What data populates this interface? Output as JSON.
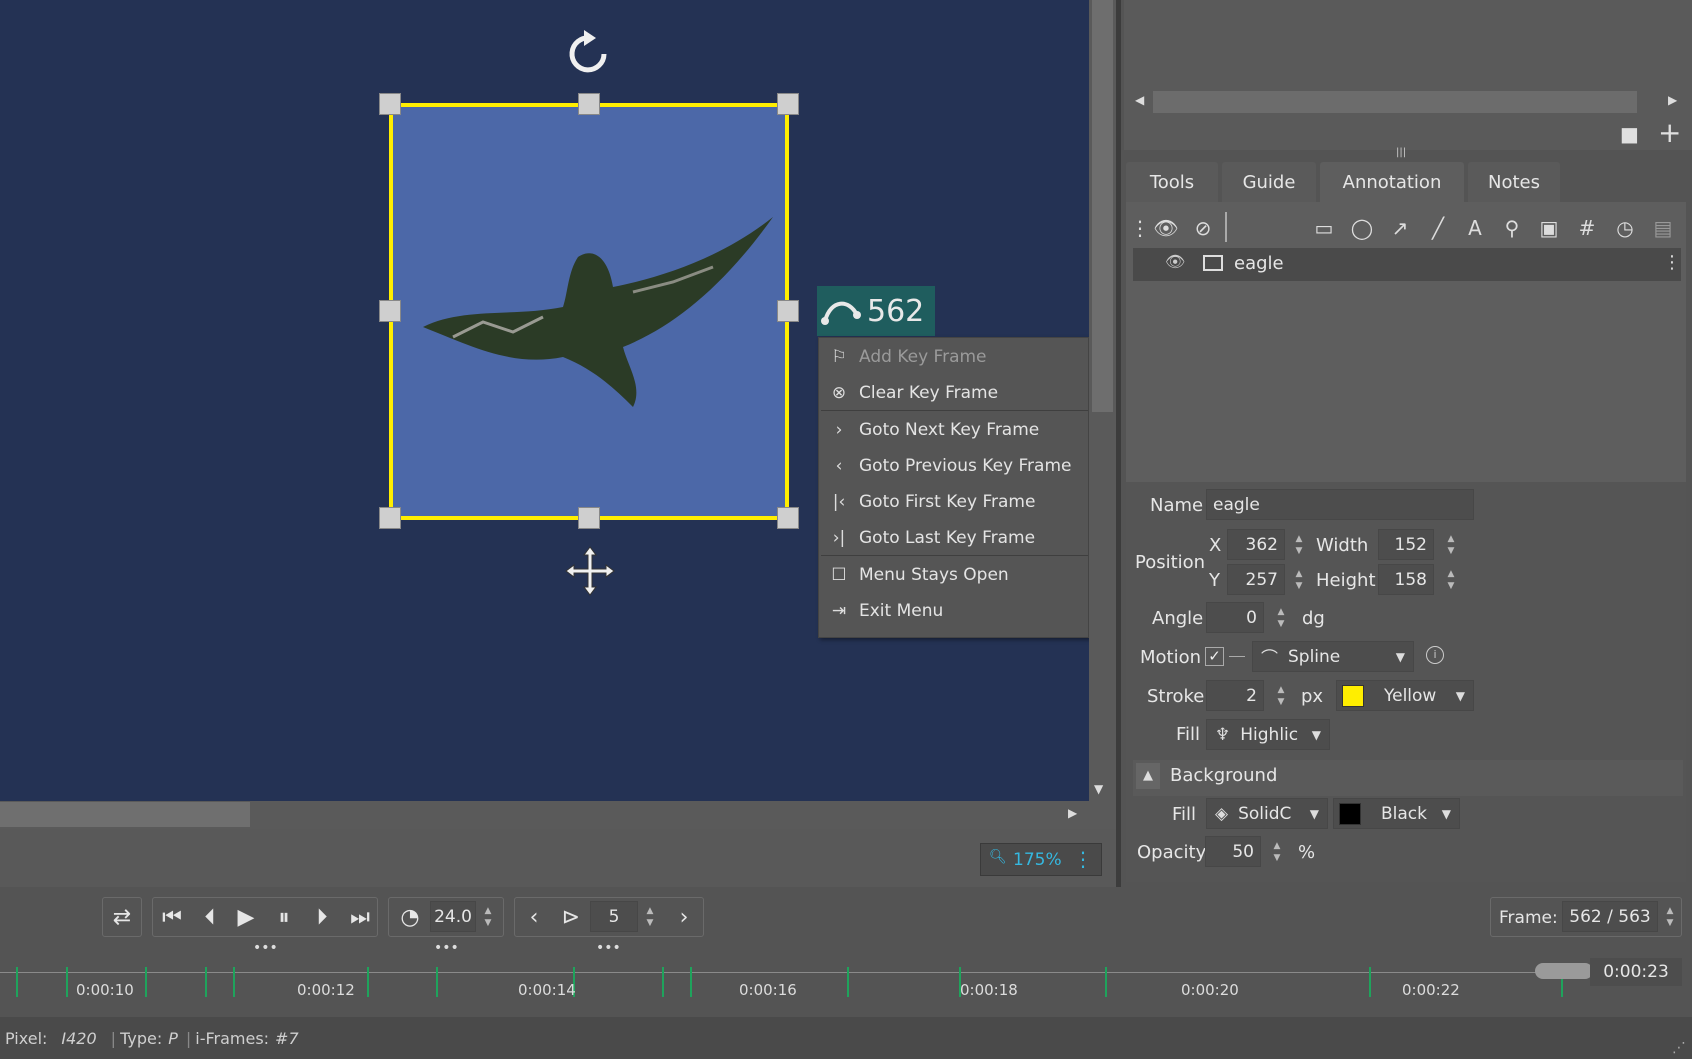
{
  "viewer": {
    "annotation_name": "eagle",
    "key_frame_number": "562",
    "rotate_icon": "rotate-icon",
    "move_icon": "move-icon",
    "zoom": "175%"
  },
  "context_menu": {
    "items": [
      {
        "label": "Add Key Frame",
        "icon": "flag-icon",
        "glyph": "⚐",
        "disabled": true
      },
      {
        "label": "Clear Key Frame",
        "icon": "clear-circle-icon",
        "glyph": "⊗",
        "disabled": false
      },
      {
        "label": "Goto Next Key Frame",
        "icon": "chevron-right-icon",
        "glyph": "›",
        "disabled": false
      },
      {
        "label": "Goto Previous Key Frame",
        "icon": "chevron-left-icon",
        "glyph": "‹",
        "disabled": false
      },
      {
        "label": "Goto First Key Frame",
        "icon": "first-key-icon",
        "glyph": "|‹",
        "disabled": false
      },
      {
        "label": "Goto Last Key Frame",
        "icon": "last-key-icon",
        "glyph": "›|",
        "disabled": false
      },
      {
        "label": "Menu Stays Open",
        "icon": "checkbox-icon",
        "glyph": "☐",
        "disabled": false
      },
      {
        "label": "Exit Menu",
        "icon": "exit-menu-icon",
        "glyph": "⇥",
        "disabled": false
      }
    ]
  },
  "tabs": [
    "Tools",
    "Guide",
    "Annotation",
    "Notes"
  ],
  "active_tab": "Annotation",
  "layer": {
    "name": "eagle"
  },
  "properties": {
    "name_label": "Name",
    "name_value": "eagle",
    "position_label": "Position",
    "x_label": "X",
    "x_value": "362",
    "y_label": "Y",
    "y_value": "257",
    "width_label": "Width",
    "width_value": "152",
    "height_label": "Height",
    "height_value": "158",
    "angle_label": "Angle",
    "angle_value": "0",
    "angle_unit": "dg",
    "motion_label": "Motion",
    "motion_value": "Spline",
    "stroke_label": "Stroke",
    "stroke_value": "2",
    "stroke_unit": "px",
    "stroke_color_name": "Yellow",
    "stroke_color": "#ffee00",
    "fill_label": "Fill",
    "fill_value": "Highlic",
    "background_label": "Background",
    "bg_fill_label": "Fill",
    "bg_fill_value": "SolidC",
    "bg_color_name": "Black",
    "bg_color": "#000000",
    "opacity_label": "Opacity",
    "opacity_value": "50",
    "opacity_unit": "%"
  },
  "transport": {
    "fps": "24.0",
    "step": "5",
    "frame_label": "Frame:",
    "frame_value": "562 / 563"
  },
  "timeline": {
    "labels": [
      "0:00:10",
      "0:00:12",
      "0:00:14",
      "0:00:16",
      "0:00:18",
      "0:00:20",
      "0:00:22"
    ],
    "current_time": "0:00:23"
  },
  "status": {
    "pixel_label": "Pixel:",
    "pixel_value": "I420",
    "type_label": "Type:",
    "type_value": "P",
    "iframes_label": "i-Frames:",
    "iframes_value": "#7"
  }
}
